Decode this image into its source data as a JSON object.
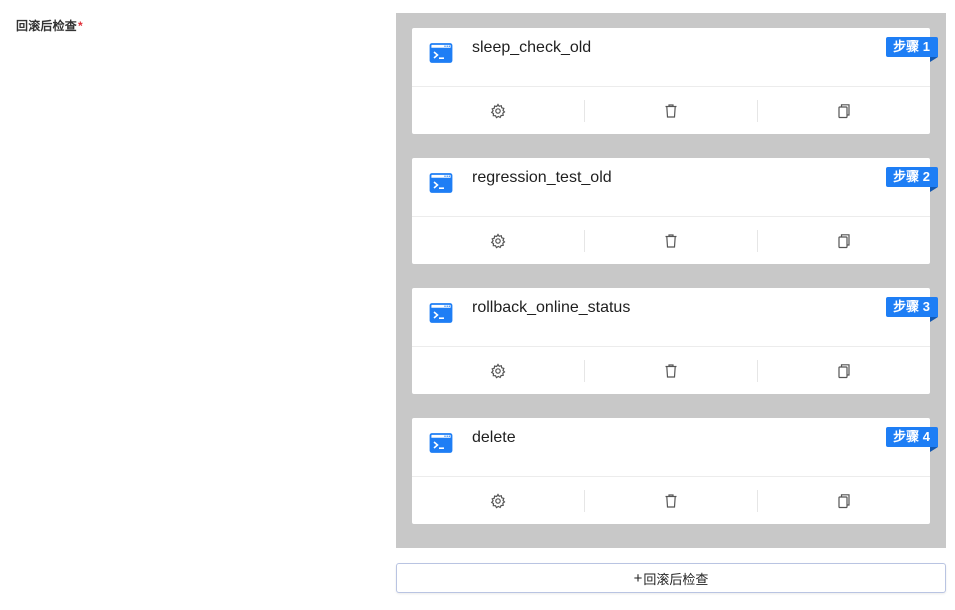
{
  "field": {
    "label": "回滚后检查",
    "required_mark": "*"
  },
  "steps": [
    {
      "name": "sleep_check_old",
      "badge": "步骤 1"
    },
    {
      "name": "regression_test_old",
      "badge": "步骤 2"
    },
    {
      "name": "rollback_online_status",
      "badge": "步骤 3"
    },
    {
      "name": "delete",
      "badge": "步骤 4"
    }
  ],
  "icons": {
    "step": "terminal-window-icon",
    "settings": "gear-icon",
    "delete": "trash-icon",
    "copy": "copy-icon"
  },
  "colors": {
    "accent": "#1e7ef5",
    "panel_bg": "#c8c8c8",
    "required": "#e0303a"
  },
  "add_button": {
    "plus": "+",
    "label": "回滚后检查"
  }
}
